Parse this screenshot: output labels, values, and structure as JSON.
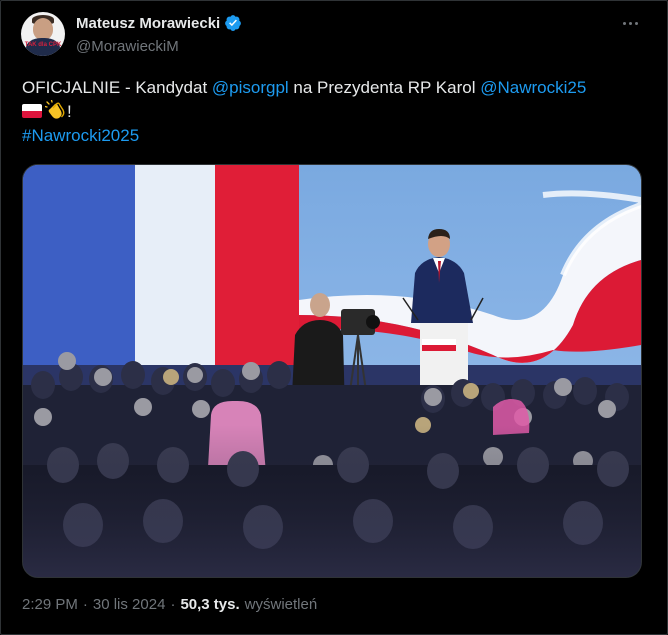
{
  "author": {
    "display_name": "Mateusz Morawiecki",
    "handle": "@MorawieckiM",
    "avatar_text": "TAK dla CPK",
    "verified_color": "#1d9bf0"
  },
  "tweet": {
    "text_prefix": "OFICJALNIE - Kandydat ",
    "mention1": "@pisorgpl",
    "text_middle": " na Prezydenta RP Karol ",
    "mention2": "@Nawrocki25",
    "line2_suffix": "!",
    "hashtag": "#Nawrocki2025",
    "emojis": [
      "poland-flag",
      "clapping-hands"
    ]
  },
  "media": {
    "description_icons": [
      "poland-flag-backdrop",
      "podium",
      "speaker",
      "camera",
      "audience"
    ]
  },
  "meta": {
    "time": "2:29 PM",
    "separator": "·",
    "date": "30 lis 2024",
    "separator2": "·",
    "views_count": "50,3 tys.",
    "views_label": "wyświetleń"
  },
  "colors": {
    "background": "#000000",
    "text": "#e7e9ea",
    "muted": "#71767b",
    "link": "#1d9bf0",
    "poland_red": "#dc143c"
  }
}
